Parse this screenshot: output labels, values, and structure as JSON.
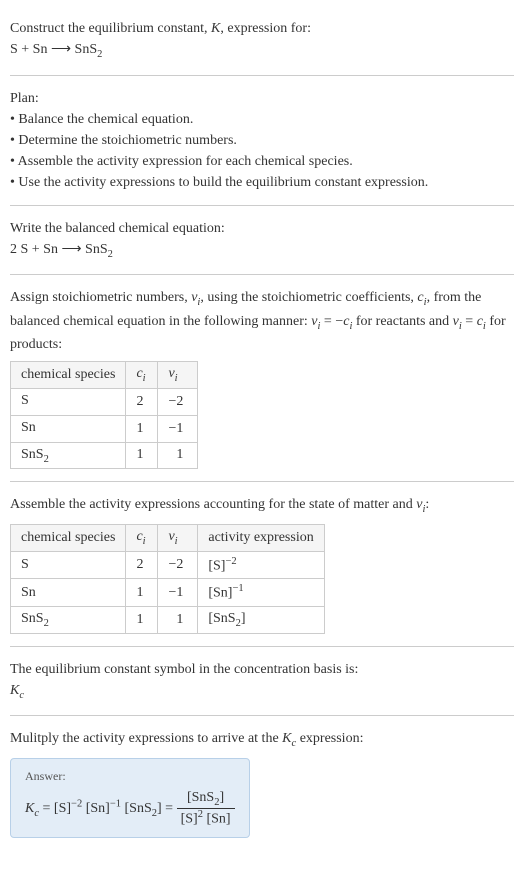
{
  "header": {
    "title_line1": "Construct the equilibrium constant, ",
    "title_K": "K",
    "title_line1_end": ", expression for:",
    "equation": "S + Sn ⟶ SnS",
    "equation_sub": "2"
  },
  "plan": {
    "heading": "Plan:",
    "bullet1": "• Balance the chemical equation.",
    "bullet2": "• Determine the stoichiometric numbers.",
    "bullet3": "• Assemble the activity expression for each chemical species.",
    "bullet4": "• Use the activity expressions to build the equilibrium constant expression."
  },
  "balanced": {
    "intro": "Write the balanced chemical equation:",
    "equation": "2 S + Sn ⟶ SnS",
    "equation_sub": "2"
  },
  "stoich": {
    "intro_p1": "Assign stoichiometric numbers, ",
    "nu_i": "ν",
    "nu_sub": "i",
    "intro_p2": ", using the stoichiometric coefficients, ",
    "c_i": "c",
    "c_sub": "i",
    "intro_p3": ", from the balanced chemical equation in the following manner: ",
    "rel1_a": "ν",
    "rel1_b": " = −",
    "rel1_c": "c",
    "intro_p4": " for reactants and ",
    "rel2_a": "ν",
    "rel2_b": " = ",
    "rel2_c": "c",
    "intro_p5": " for products:",
    "table": {
      "h1": "chemical species",
      "h2_a": "c",
      "h2_b": "i",
      "h3_a": "ν",
      "h3_b": "i",
      "rows": [
        {
          "species": "S",
          "species_sub": "",
          "c": "2",
          "nu": "−2"
        },
        {
          "species": "Sn",
          "species_sub": "",
          "c": "1",
          "nu": "−1"
        },
        {
          "species": "SnS",
          "species_sub": "2",
          "c": "1",
          "nu": "1"
        }
      ]
    }
  },
  "activity": {
    "intro_p1": "Assemble the activity expressions accounting for the state of matter and ",
    "nu": "ν",
    "nu_sub": "i",
    "intro_p2": ":",
    "table": {
      "h1": "chemical species",
      "h2_a": "c",
      "h2_b": "i",
      "h3_a": "ν",
      "h3_b": "i",
      "h4": "activity expression",
      "rows": [
        {
          "species": "S",
          "species_sub": "",
          "c": "2",
          "nu": "−2",
          "expr_base": "[S]",
          "expr_sup": "−2"
        },
        {
          "species": "Sn",
          "species_sub": "",
          "c": "1",
          "nu": "−1",
          "expr_base": "[Sn]",
          "expr_sup": "−1"
        },
        {
          "species": "SnS",
          "species_sub": "2",
          "c": "1",
          "nu": "1",
          "expr_base": "[SnS",
          "expr_sub": "2",
          "expr_close": "]",
          "expr_sup": ""
        }
      ]
    }
  },
  "symbol": {
    "intro": "The equilibrium constant symbol in the concentration basis is:",
    "K": "K",
    "Ksub": "c"
  },
  "multiply": {
    "intro_p1": "Mulitply the activity expressions to arrive at the ",
    "K": "K",
    "Ksub": "c",
    "intro_p2": " expression:"
  },
  "answer": {
    "label": "Answer:",
    "lhs_K": "K",
    "lhs_Ksub": "c",
    "eq": " = ",
    "term1_base": "[S]",
    "term1_sup": "−2",
    "term2_base": " [Sn]",
    "term2_sup": "−1",
    "term3_base": " [SnS",
    "term3_sub": "2",
    "term3_close": "] = ",
    "frac_num_a": "[SnS",
    "frac_num_sub": "2",
    "frac_num_b": "]",
    "frac_den_a": "[S]",
    "frac_den_sup": "2",
    "frac_den_b": " [Sn]"
  }
}
